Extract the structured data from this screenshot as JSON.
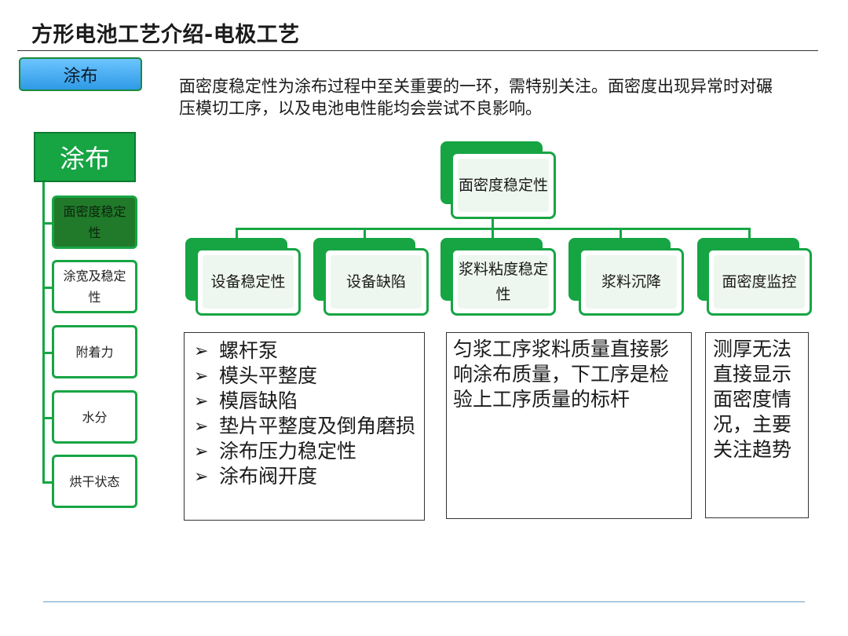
{
  "page": {
    "title": "方形电池工艺介绍-电极工艺",
    "tag": "涂布",
    "intro": "面密度稳定性为涂布过程中至关重要的一环，需特别关注。面密度出现异常时对碾压模切工序，以及电池电性能均会尝试不良影响。"
  },
  "nav": {
    "head": "涂布",
    "items": [
      {
        "label": "面密度稳定性",
        "active": true
      },
      {
        "label": "涂宽及稳定性",
        "active": false
      },
      {
        "label": "附着力",
        "active": false
      },
      {
        "label": "水分",
        "active": false
      },
      {
        "label": "烘干状态",
        "active": false
      }
    ]
  },
  "tree": {
    "root": "面密度稳定性",
    "children": [
      "设备稳定性",
      "设备缺陷",
      "浆料粘度稳定性",
      "浆料沉降",
      "面密度监控"
    ]
  },
  "boxes": {
    "equipment": {
      "items": [
        "螺杆泵",
        "模头平整度",
        "模唇缺陷",
        "垫片平整度及倒角磨损",
        "涂布压力稳定性",
        "涂布阀开度"
      ]
    },
    "slurry": "匀浆工序浆料质量直接影响涂布质量，下工序是检验上工序质量的标杆",
    "monitor": "测厚无法直接显示面密度情况，主要关注趋势"
  },
  "colors": {
    "green": "#17a544",
    "dark_green": "#217a2a",
    "tag_blue": "#2f9ae6"
  },
  "icons": {
    "bullet": "arrow-right-icon"
  }
}
